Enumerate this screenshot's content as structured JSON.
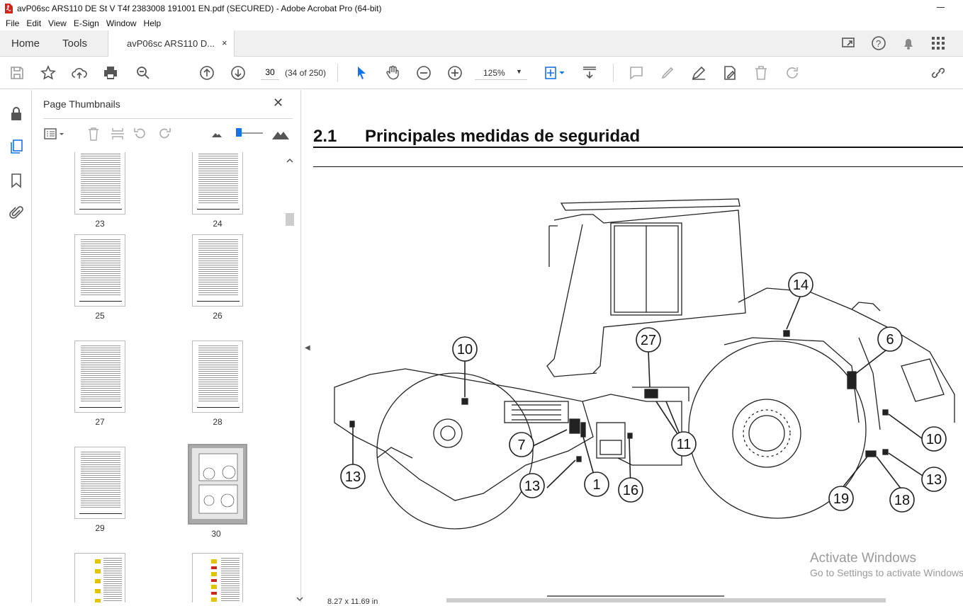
{
  "window": {
    "title": "avP06sc ARS110 DE St V T4f 2383008 191001 EN.pdf (SECURED) - Adobe Acrobat Pro (64-bit)"
  },
  "menu": [
    "File",
    "Edit",
    "View",
    "E-Sign",
    "Window",
    "Help"
  ],
  "tabs": {
    "home": "Home",
    "tools": "Tools",
    "document": "avP06sc ARS110 D...",
    "close": "×"
  },
  "toolbar": {
    "page_number": "30",
    "page_count": "(34 of 250)",
    "zoom": "125%",
    "zoom_caret": "▼"
  },
  "panel": {
    "title": "Page Thumbnails",
    "close": "✕",
    "thumbnails": [
      {
        "label": "23"
      },
      {
        "label": "24"
      },
      {
        "label": "25"
      },
      {
        "label": "26"
      },
      {
        "label": "27"
      },
      {
        "label": "28"
      },
      {
        "label": "29"
      },
      {
        "label": "30",
        "selected": true
      },
      {
        "label": ""
      },
      {
        "label": ""
      }
    ]
  },
  "document": {
    "section_number": "2.1",
    "section_title": "Principales medidas de seguridad",
    "callouts": [
      "10",
      "27",
      "14",
      "6",
      "13",
      "7",
      "13",
      "1",
      "16",
      "11",
      "10",
      "13",
      "19",
      "18"
    ],
    "page_size": "8.27 x 11.69 in"
  },
  "watermark": {
    "line1": "Activate Windows",
    "line2": "Go to Settings to activate Windows."
  },
  "colors": {
    "accent": "#1473e6",
    "pdf_red": "#d4231f"
  }
}
